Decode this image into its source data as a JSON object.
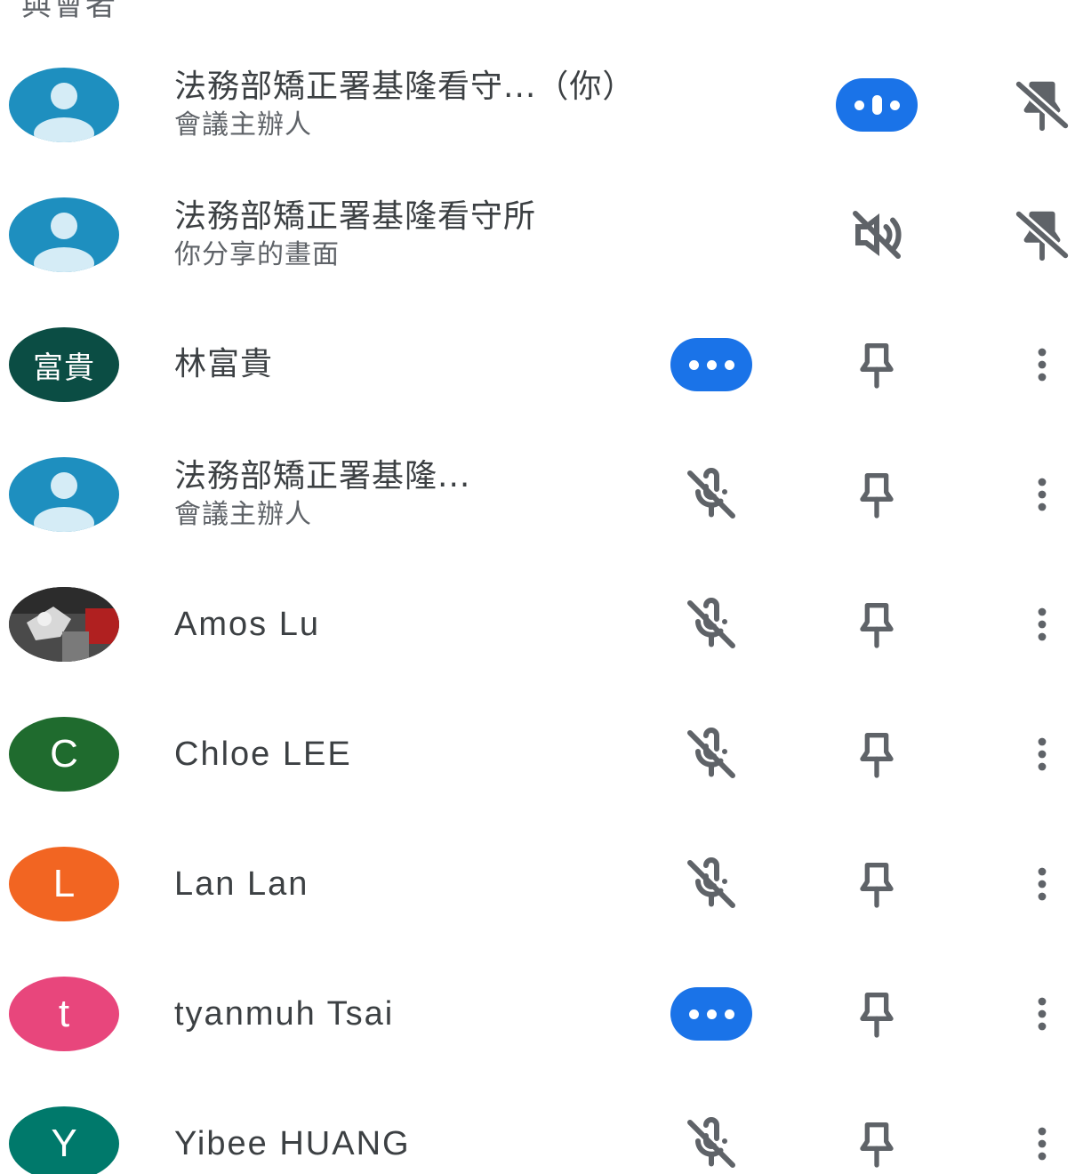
{
  "section": {
    "header": "與會者"
  },
  "participants": [
    {
      "name": "法務部矯正署基隆看守...（你）",
      "subtitle": "會議主辦人",
      "avatar": {
        "type": "default-person-icon",
        "color": "#1e8fbf"
      },
      "audio": "speaking-indicator",
      "pin": "pin-disabled-icon",
      "menu": false
    },
    {
      "name": "法務部矯正署基隆看守所",
      "subtitle": "你分享的畫面",
      "avatar": {
        "type": "default-person-icon",
        "color": "#1e8fbf"
      },
      "audio": "audio-off-icon",
      "pin": "pin-disabled-icon",
      "menu": false
    },
    {
      "name": "林富貴",
      "subtitle": "",
      "avatar": {
        "type": "initials",
        "text": "富貴",
        "color": "#0b4d44"
      },
      "audio": "speaking-indicator",
      "pin": "pin-icon",
      "menu": true
    },
    {
      "name": "法務部矯正署基隆...",
      "subtitle": "會議主辦人",
      "avatar": {
        "type": "default-person-icon",
        "color": "#1e8fbf"
      },
      "audio": "mic-off-icon",
      "pin": "pin-icon",
      "menu": true
    },
    {
      "name": "Amos Lu",
      "subtitle": "",
      "avatar": {
        "type": "photo",
        "color": "#3a3a3a"
      },
      "audio": "mic-off-icon",
      "pin": "pin-icon",
      "menu": true
    },
    {
      "name": "Chloe LEE",
      "subtitle": "",
      "avatar": {
        "type": "initials",
        "text": "C",
        "color": "#1f6b2e"
      },
      "audio": "mic-off-icon",
      "pin": "pin-icon",
      "menu": true
    },
    {
      "name": "Lan Lan",
      "subtitle": "",
      "avatar": {
        "type": "initials",
        "text": "L",
        "color": "#f26522"
      },
      "audio": "mic-off-icon",
      "pin": "pin-icon",
      "menu": true
    },
    {
      "name": "tyanmuh Tsai",
      "subtitle": "",
      "avatar": {
        "type": "initials",
        "text": "t",
        "color": "#e8467c"
      },
      "audio": "speaking-indicator",
      "pin": "pin-icon",
      "menu": true
    },
    {
      "name": "Yibee HUANG",
      "subtitle": "",
      "avatar": {
        "type": "initials",
        "text": "Y",
        "color": "#00796b"
      },
      "audio": "mic-off-icon",
      "pin": "pin-icon",
      "menu": true
    }
  ],
  "colors": {
    "accent": "#1a73e8",
    "icon": "#5f6368",
    "text": "#3c4043"
  }
}
